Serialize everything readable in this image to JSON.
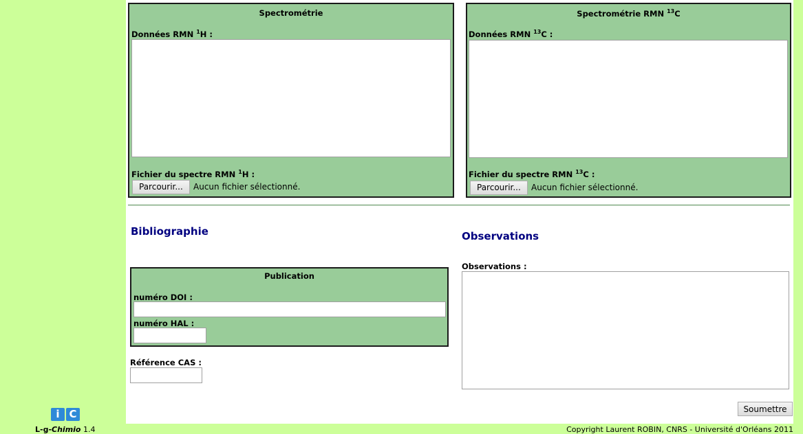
{
  "spectrometry": {
    "title": "Spectrométrie",
    "h1_label_pre": "Données RMN ",
    "h1_label_sup": "1",
    "h1_label_post": "H :",
    "h1_file_label_pre": "Fichier du spectre RMN ",
    "h1_file_label_sup": "1",
    "h1_file_label_post": "H :",
    "browse_label": "Parcourir...",
    "no_file_text": "Aucun fichier sélectionné."
  },
  "spectrometry_c13": {
    "title_pre": "Spectrométrie RMN ",
    "title_sup": "13",
    "title_post": "C",
    "c13_label_pre": "Données RMN ",
    "c13_label_sup": "13",
    "c13_label_post": "C :",
    "c13_file_label_pre": "Fichier du spectre RMN ",
    "c13_file_label_sup": "13",
    "c13_file_label_post": "C :",
    "browse_label": "Parcourir...",
    "no_file_text": "Aucun fichier sélectionné."
  },
  "bibliography": {
    "heading": "Bibliographie",
    "publication_title": "Publication",
    "doi_label": "numéro DOI :",
    "doi_value": "",
    "hal_label": "numéro HAL :",
    "hal_value": "",
    "cas_label": "Référence CAS :",
    "cas_value": ""
  },
  "observations": {
    "heading": "Observations",
    "label": "Observations :",
    "value": ""
  },
  "submit_label": "Soumettre",
  "footer": {
    "logo_i": "i",
    "logo_c": "C",
    "app_prefix": "L-g-",
    "app_italic": "Chimio",
    "app_version": " 1.4",
    "copyright": "Copyright Laurent ROBIN, CNRS - Université d'Orléans 2011"
  },
  "colors": {
    "page_bg": "#ccff99",
    "fieldset_bg": "#99cc99",
    "heading": "#000080",
    "logo": "#2e8ad8"
  }
}
